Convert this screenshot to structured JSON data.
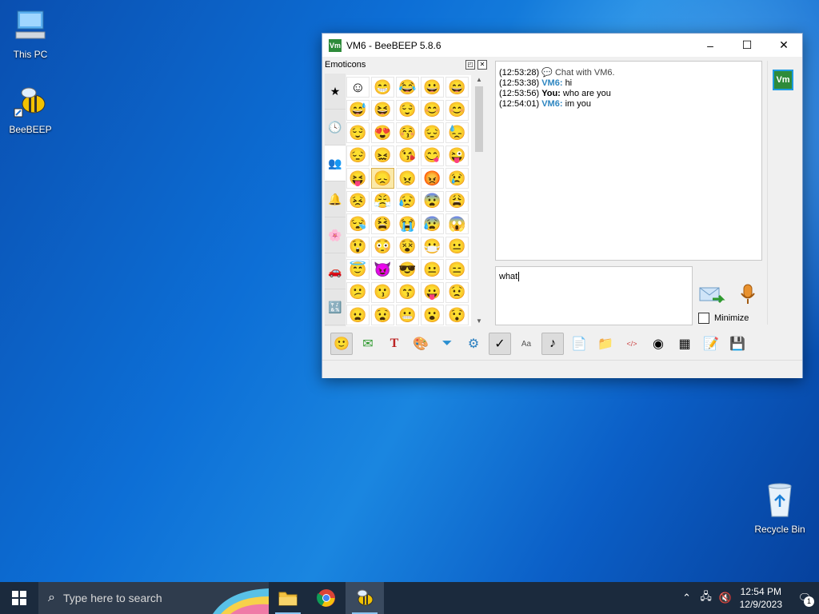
{
  "desktop": {
    "icons": [
      {
        "label": "This PC"
      },
      {
        "label": "BeeBEEP"
      },
      {
        "label": "Recycle Bin"
      }
    ]
  },
  "window": {
    "title": "VM6 - BeeBEEP 5.8.6",
    "app_icon_text": "Vm",
    "minimize_label": "–",
    "maximize_label": "☐",
    "close_label": "✕"
  },
  "emoticons_panel": {
    "title": "Emoticons",
    "float_label": "◰",
    "close_label": "✕",
    "category_icons": [
      "star-icon",
      "clock-icon",
      "people-icon",
      "bell-icon",
      "flower-icon",
      "car-icon",
      "symbols-icon"
    ],
    "category_glyphs": [
      "★",
      "🕓",
      "👥",
      "🔔",
      "🌸",
      "🚗",
      "🔣"
    ],
    "emojis": [
      "☺",
      "😁",
      "😂",
      "😀",
      "😄",
      "😅",
      "😆",
      "😌",
      "😊",
      "😊",
      "😌",
      "😍",
      "😚",
      "😔",
      "😓",
      "😔",
      "😖",
      "😘",
      "😋",
      "😜",
      "😝",
      "😞",
      "😠",
      "😡",
      "😢",
      "😣",
      "😤",
      "😥",
      "😨",
      "😩",
      "😪",
      "😫",
      "😭",
      "😰",
      "😱",
      "😲",
      "😳",
      "😵",
      "😷",
      "😐",
      "😇",
      "😈",
      "😎",
      "😐",
      "😑",
      "😕",
      "😗",
      "😙",
      "😛",
      "😟",
      "😦",
      "😧",
      "😬",
      "😮",
      "😯"
    ]
  },
  "chat": {
    "messages": [
      {
        "time": "(12:53:28)",
        "sender": "",
        "text": "Chat with VM6."
      },
      {
        "time": "(12:53:38)",
        "sender": "VM6:",
        "text": "hi"
      },
      {
        "time": "(12:53:56)",
        "sender": "You:",
        "text": "who are you"
      },
      {
        "time": "(12:54:01)",
        "sender": "VM6:",
        "text": "im you"
      }
    ],
    "input_value": "what ",
    "minimize_label": "Minimize",
    "avatar_text": "Vm"
  },
  "toolbar": {
    "buttons": [
      {
        "name": "emoticons-icon",
        "glyph": "🙂"
      },
      {
        "name": "email-icon",
        "glyph": "✉"
      },
      {
        "name": "font-icon",
        "glyph": "T"
      },
      {
        "name": "color-palette-icon",
        "glyph": "🎨"
      },
      {
        "name": "filter-icon",
        "glyph": "⏷"
      },
      {
        "name": "settings-icon",
        "glyph": "⚙"
      },
      {
        "name": "spellcheck-icon",
        "glyph": "✓"
      },
      {
        "name": "text-size-icon",
        "glyph": "Aa"
      },
      {
        "name": "music-note-icon",
        "glyph": "♪"
      },
      {
        "name": "file-transfer-icon",
        "glyph": "📄"
      },
      {
        "name": "folder-send-icon",
        "glyph": "📁"
      },
      {
        "name": "code-icon",
        "glyph": "</>"
      },
      {
        "name": "camera-icon",
        "glyph": "◉"
      },
      {
        "name": "screenshot-icon",
        "glyph": "▦"
      },
      {
        "name": "notes-icon",
        "glyph": "📝"
      },
      {
        "name": "save-icon",
        "glyph": "💾"
      }
    ]
  },
  "taskbar": {
    "search_placeholder": "Type here to search",
    "time": "12:54 PM",
    "date": "12/9/2023",
    "notification_count": "1"
  }
}
